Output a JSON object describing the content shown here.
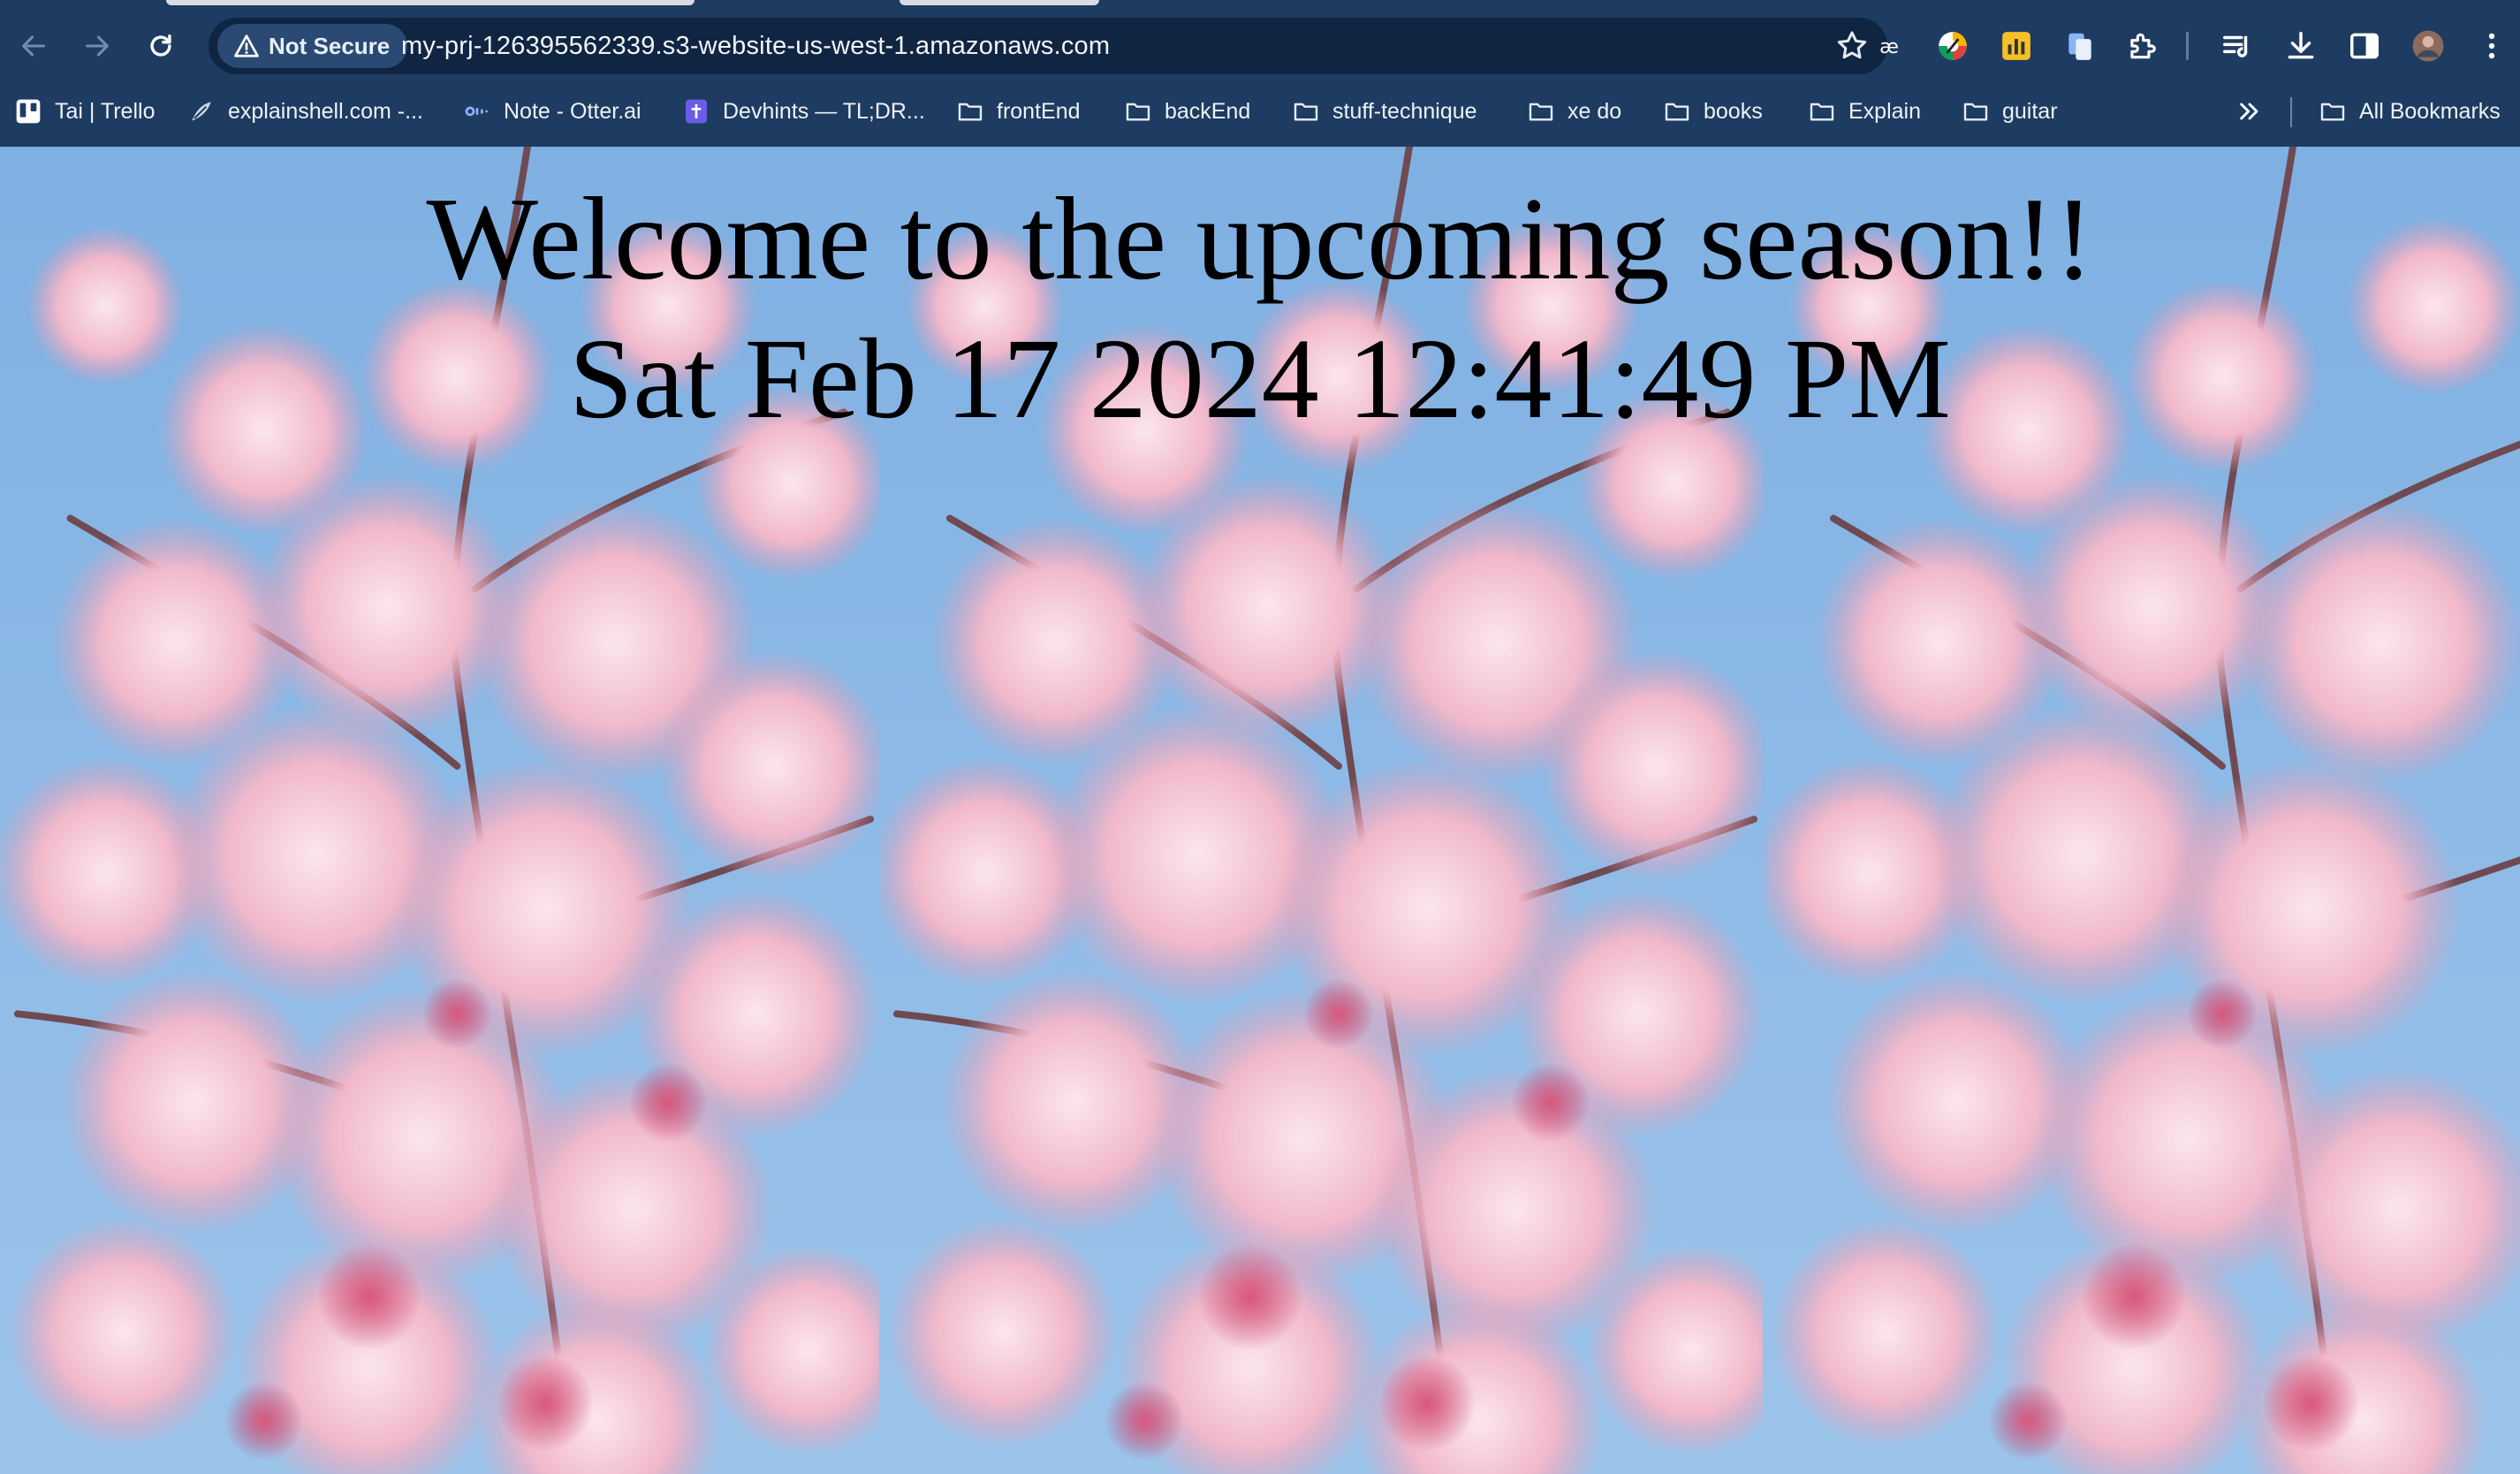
{
  "browser": {
    "security_label": "Not Secure",
    "url": "my-prj-126395562339.s3-website-us-west-1.amazonaws.com",
    "toolbar_icons": [
      "back-arrow-icon",
      "forward-arrow-icon",
      "reload-icon",
      "warning-triangle-icon",
      "bookmark-star-icon",
      "dictionary-extension-icon",
      "color-picker-extension-icon",
      "chart-extension-icon",
      "document-extension-icon",
      "puzzle-extensions-icon",
      "reading-list-icon",
      "download-icon",
      "side-panel-icon",
      "profile-avatar"
    ]
  },
  "bookmarks": {
    "items": [
      {
        "label": "Tai | Trello",
        "icon": "trello-icon"
      },
      {
        "label": "explainshell.com -...",
        "icon": "explainshell-icon"
      },
      {
        "label": "Note - Otter.ai",
        "icon": "otter-icon"
      },
      {
        "label": "Devhints — TL;DR...",
        "icon": "devhints-icon"
      },
      {
        "label": "frontEnd",
        "icon": "folder-icon"
      },
      {
        "label": "backEnd",
        "icon": "folder-icon"
      },
      {
        "label": "stuff-technique",
        "icon": "folder-icon"
      },
      {
        "label": "xe do",
        "icon": "folder-icon"
      },
      {
        "label": "books",
        "icon": "folder-icon"
      },
      {
        "label": "Explain",
        "icon": "folder-icon"
      },
      {
        "label": "guitar",
        "icon": "folder-icon"
      }
    ],
    "overflow_icon": "chevron-double-right-icon",
    "all_bookmarks_label": "All Bookmarks"
  },
  "page": {
    "heading": "Welcome to the upcoming season!!",
    "datetime": "Sat Feb 17 2024 12:41:49 PM",
    "background": "cherry-blossom-image-tiled"
  },
  "colors": {
    "chrome_bg": "#1e3c61",
    "omnibox_bg": "#0f2542",
    "sky": "#8fbbe5",
    "blossom": "#f3c6d3"
  }
}
